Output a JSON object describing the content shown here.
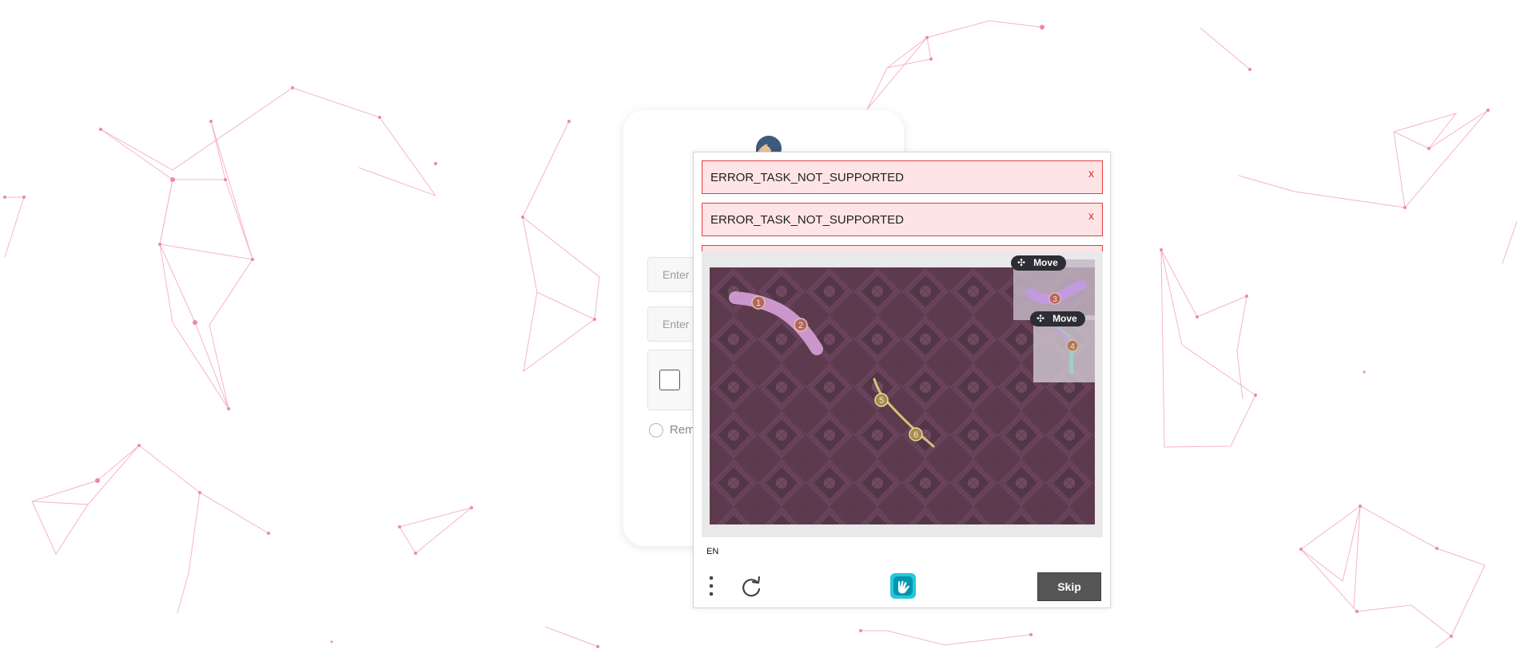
{
  "login": {
    "username_placeholder": "Enter",
    "password_placeholder": "Enter",
    "remember_label": "Rem"
  },
  "captcha": {
    "errors": [
      {
        "text": "ERROR_TASK_NOT_SUPPORTED",
        "close": "x"
      },
      {
        "text": "ERROR_TASK_NOT_SUPPORTED",
        "close": "x"
      }
    ],
    "move_labels": [
      "Move",
      "Move"
    ],
    "markers": [
      "1",
      "2",
      "3",
      "4",
      "5",
      "6"
    ],
    "language": "EN",
    "skip_label": "Skip"
  },
  "icons": {
    "menu": "more-vertical-icon",
    "refresh": "refresh-icon",
    "logo": "hcaptcha-logo-icon",
    "move": "move-arrows-icon"
  },
  "colors": {
    "error_bg": "#ffe4e6",
    "error_border": "#e53c3c",
    "network": "#f0a0b0",
    "skip_bg": "#555555"
  }
}
